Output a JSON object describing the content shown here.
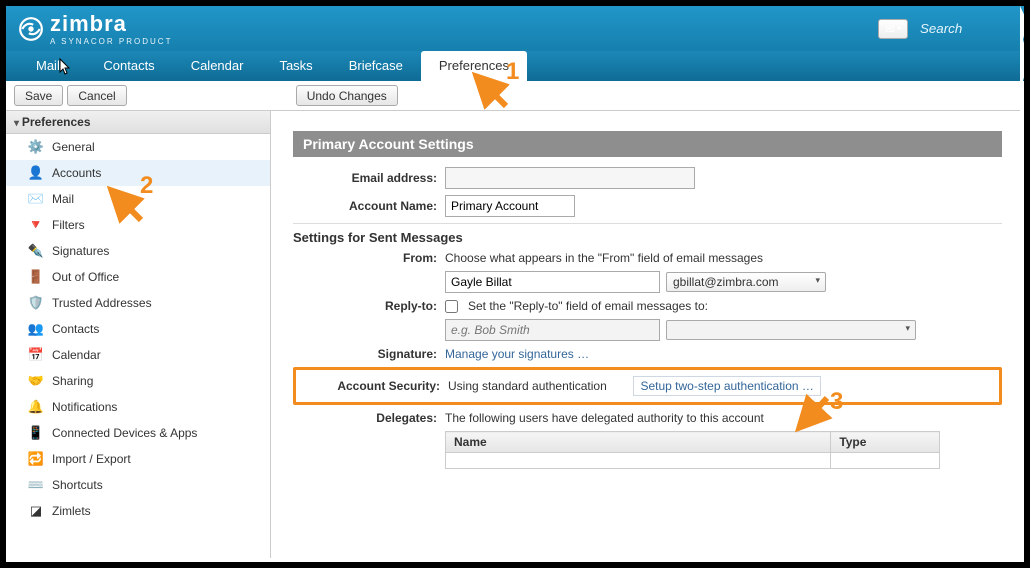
{
  "app": {
    "name": "zimbra",
    "subtitle": "A SYNACOR PRODUCT"
  },
  "search": {
    "placeholder": "Search"
  },
  "nav": {
    "mail": "Mail",
    "contacts": "Contacts",
    "calendar": "Calendar",
    "tasks": "Tasks",
    "briefcase": "Briefcase",
    "preferences": "Preferences"
  },
  "toolbar": {
    "save": "Save",
    "cancel": "Cancel",
    "undo": "Undo Changes"
  },
  "sidebar": {
    "header": "Preferences",
    "items": [
      {
        "label": "General",
        "icon": "⚙️"
      },
      {
        "label": "Accounts",
        "icon": "👤"
      },
      {
        "label": "Mail",
        "icon": "✉️"
      },
      {
        "label": "Filters",
        "icon": "🔻"
      },
      {
        "label": "Signatures",
        "icon": "✒️"
      },
      {
        "label": "Out of Office",
        "icon": "🚪"
      },
      {
        "label": "Trusted Addresses",
        "icon": "🛡️"
      },
      {
        "label": "Contacts",
        "icon": "👥"
      },
      {
        "label": "Calendar",
        "icon": "📅"
      },
      {
        "label": "Sharing",
        "icon": "🤝"
      },
      {
        "label": "Notifications",
        "icon": "🔔"
      },
      {
        "label": "Connected Devices & Apps",
        "icon": "📱"
      },
      {
        "label": "Import / Export",
        "icon": "🔁"
      },
      {
        "label": "Shortcuts",
        "icon": "⌨️"
      },
      {
        "label": "Zimlets",
        "icon": "◪"
      }
    ]
  },
  "panel": {
    "title": "Primary Account Settings",
    "emailLabel": "Email address:",
    "accountNameLabel": "Account Name:",
    "accountName": "Primary Account",
    "sentHeader": "Settings for Sent Messages",
    "fromLabel": "From:",
    "fromHint": "Choose what appears in the \"From\" field of email messages",
    "fromName": "Gayle Billat",
    "fromEmail": "gbillat@zimbra.com",
    "replyToLabel": "Reply-to:",
    "replyToCheckbox": "Set the \"Reply-to\" field of email messages to:",
    "replyToPlaceholder": "e.g. Bob Smith",
    "signatureLabel": "Signature:",
    "signatureLink": "Manage your signatures …",
    "securityLabel": "Account Security:",
    "securityText": "Using standard authentication",
    "securityLink": "Setup two-step authentication …",
    "delegatesLabel": "Delegates:",
    "delegatesText": "The following users have delegated authority to this account",
    "tbl": {
      "name": "Name",
      "type": "Type"
    }
  },
  "annotations": {
    "n1": "1",
    "n2": "2",
    "n3": "3"
  }
}
